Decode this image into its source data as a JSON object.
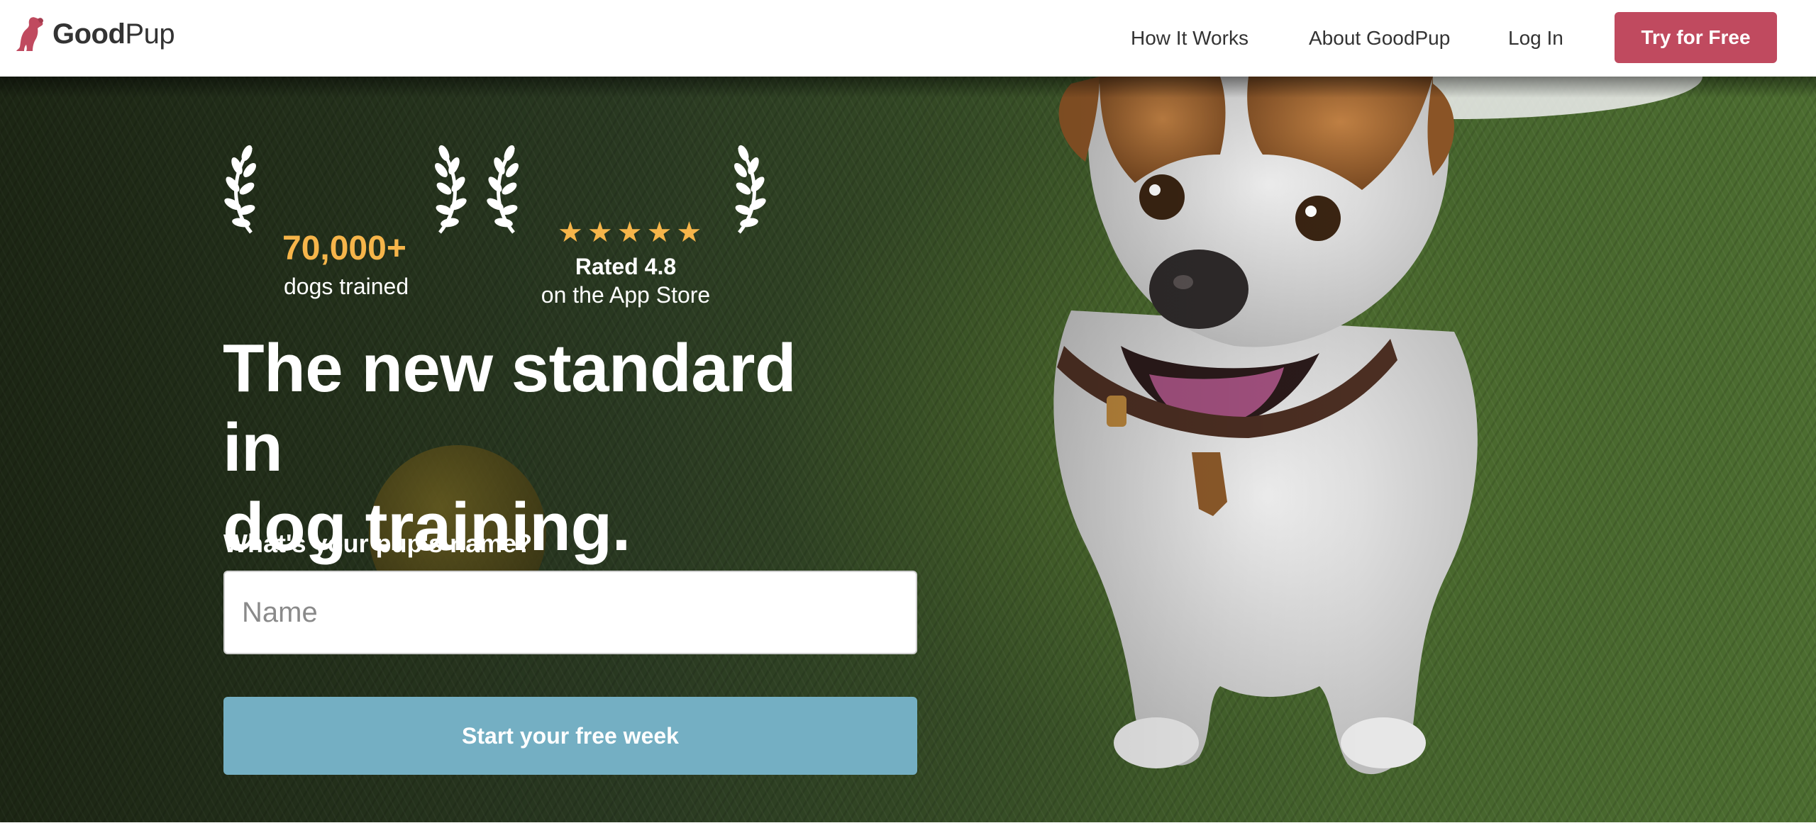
{
  "brand": {
    "name_bold": "Good",
    "name_regular": "Pup",
    "accent_color": "#c04a5f",
    "logo_icon": "dog-logo-icon"
  },
  "nav": {
    "items": [
      {
        "label": "How It Works"
      },
      {
        "label": "About GoodPup"
      },
      {
        "label": "Log In"
      }
    ],
    "cta_label": "Try for Free"
  },
  "hero": {
    "badges": [
      {
        "value": "70,000+",
        "label": "dogs trained"
      },
      {
        "stars": 5,
        "rating": "Rated 4.8",
        "label": "on the App Store"
      }
    ],
    "headline_line1": "The new standard in",
    "headline_line2": "dog training.",
    "question": "What's your pup's name?",
    "name_placeholder": "Name",
    "name_value": "",
    "submit_label": "Start your free week",
    "colors": {
      "star": "#f6b54a",
      "submit": "#74afc3"
    }
  }
}
